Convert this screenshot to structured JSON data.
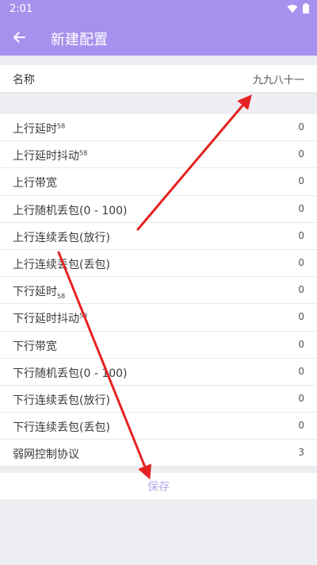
{
  "status_bar": {
    "time": "2:01"
  },
  "app_bar": {
    "title": "新建配置"
  },
  "name_field": {
    "label": "名称",
    "value": "九九八十一"
  },
  "settings": [
    {
      "label": "上行延时",
      "mark": "58",
      "mark_type": "sup",
      "value": "0"
    },
    {
      "label": "上行延时抖动",
      "mark": "58",
      "mark_type": "sup",
      "value": "0"
    },
    {
      "label": "上行带宽",
      "mark": "",
      "mark_type": "",
      "value": "0"
    },
    {
      "label": "上行随机丢包(0 - 100)",
      "mark": "",
      "mark_type": "",
      "value": "0"
    },
    {
      "label": "上行连续丢包(放行)",
      "mark": "",
      "mark_type": "",
      "value": "0"
    },
    {
      "label": "上行连续丢包(丢包)",
      "mark": "",
      "mark_type": "",
      "value": "0"
    },
    {
      "label": "下行延时",
      "mark": "58",
      "mark_type": "sub",
      "value": "0"
    },
    {
      "label": "下行延时抖动",
      "mark": "58",
      "mark_type": "sup",
      "value": "0"
    },
    {
      "label": "下行带宽",
      "mark": "",
      "mark_type": "",
      "value": "0"
    },
    {
      "label": "下行随机丢包(0 - 100)",
      "mark": "",
      "mark_type": "",
      "value": "0"
    },
    {
      "label": "下行连续丢包(放行)",
      "mark": "",
      "mark_type": "",
      "value": "0"
    },
    {
      "label": "下行连续丢包(丢包)",
      "mark": "",
      "mark_type": "",
      "value": "0"
    },
    {
      "label": "弱网控制协议",
      "mark": "",
      "mark_type": "",
      "value": "3"
    }
  ],
  "save_label": "保存",
  "colors": {
    "accent": "#a692ee",
    "annotation": "#e52222",
    "save_text": "#b8a7ef"
  },
  "icons": {
    "back": "arrow-left-icon",
    "wifi": "wifi-icon",
    "battery": "battery-icon"
  }
}
